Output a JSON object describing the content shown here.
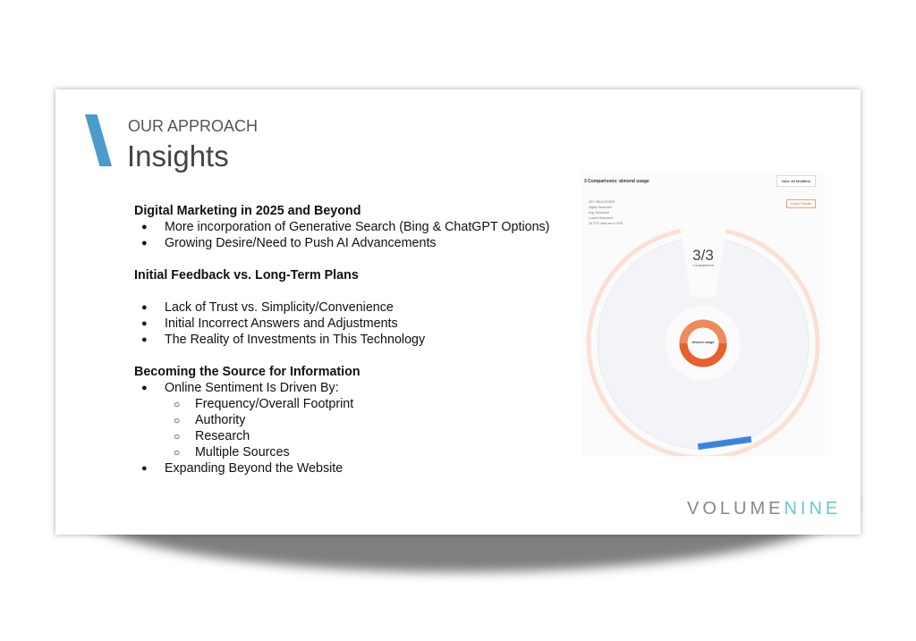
{
  "slide": {
    "kicker": "OUR APPROACH",
    "title": "Insights",
    "accent_color": "#4b9ccb",
    "sections": [
      {
        "heading": "Digital Marketing in 2025 and Beyond",
        "items": [
          "More incorporation of Generative Search (Bing & ChatGPT Options)",
          "Growing Desire/Need to Push AI Advancements"
        ]
      },
      {
        "heading": "Initial Feedback vs. Long-Term Plans",
        "items": [
          "Lack of Trust vs. Simplicity/Convenience",
          "Initial Incorrect Answers and Adjustments",
          "The Reality of Investments in This Technology"
        ]
      },
      {
        "heading": "Becoming the Source for Information",
        "items": [
          "Online Sentiment Is Driven By:",
          "Expanding Beyond the Website"
        ],
        "subitems": [
          "Frequency/Overall Footprint",
          "Authority",
          "Research",
          "Multiple Sources"
        ]
      }
    ],
    "screenshot": {
      "title": "3 Comparisons: almond usage",
      "dropdown": "View: All Modifiers",
      "legend": [
        "KEY INDICATORS",
        "Highly Searched",
        "Avg. Searched",
        "Lowest Searched",
        "All CPC data are in USD"
      ],
      "export": "Export Results",
      "count": "3/3",
      "count_label": "Comparisons",
      "center": "almond usage"
    },
    "logo": {
      "part1": "VOLUME",
      "part2": "NINE"
    }
  }
}
